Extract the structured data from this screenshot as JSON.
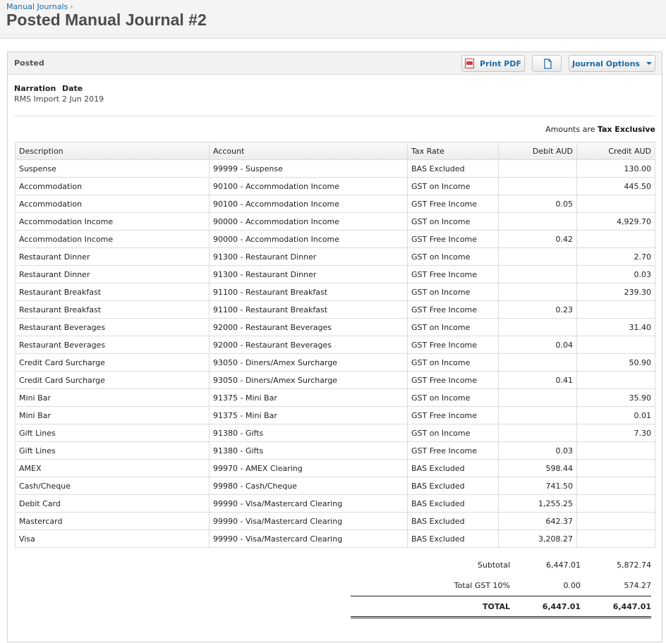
{
  "breadcrumb": {
    "link": "Manual Journals",
    "separator": "›"
  },
  "title": "Posted Manual Journal #2",
  "panel": {
    "status": "Posted",
    "print_pdf_label": "Print PDF",
    "copy_icon": "copy-icon",
    "journal_options_label": "Journal Options"
  },
  "narration": {
    "label": "Narration",
    "value": "RMS Import"
  },
  "date": {
    "label": "Date",
    "value": "2 Jun 2019"
  },
  "amounts_note": {
    "prefix": "Amounts are",
    "value": "Tax Exclusive"
  },
  "table": {
    "columns": [
      "Description",
      "Account",
      "Tax Rate",
      "Debit AUD",
      "Credit AUD"
    ],
    "rows": [
      {
        "description": "Suspense",
        "account": "99999 - Suspense",
        "tax_rate": "BAS Excluded",
        "debit": "",
        "credit": "130.00"
      },
      {
        "description": "Accommodation",
        "account": "90100 - Accommodation Income",
        "tax_rate": "GST on Income",
        "debit": "",
        "credit": "445.50"
      },
      {
        "description": "Accommodation",
        "account": "90100 - Accommodation Income",
        "tax_rate": "GST Free Income",
        "debit": "0.05",
        "credit": ""
      },
      {
        "description": "Accommodation Income",
        "account": "90000 - Accommodation Income",
        "tax_rate": "GST on Income",
        "debit": "",
        "credit": "4,929.70"
      },
      {
        "description": "Accommodation Income",
        "account": "90000 - Accommodation Income",
        "tax_rate": "GST Free Income",
        "debit": "0.42",
        "credit": ""
      },
      {
        "description": "Restaurant Dinner",
        "account": "91300 - Restaurant Dinner",
        "tax_rate": "GST on Income",
        "debit": "",
        "credit": "2.70"
      },
      {
        "description": "Restaurant Dinner",
        "account": "91300 - Restaurant Dinner",
        "tax_rate": "GST Free Income",
        "debit": "",
        "credit": "0.03"
      },
      {
        "description": "Restaurant Breakfast",
        "account": "91100 - Restaurant Breakfast",
        "tax_rate": "GST on Income",
        "debit": "",
        "credit": "239.30"
      },
      {
        "description": "Restaurant Breakfast",
        "account": "91100 - Restaurant Breakfast",
        "tax_rate": "GST Free Income",
        "debit": "0.23",
        "credit": ""
      },
      {
        "description": "Restaurant Beverages",
        "account": "92000 - Restaurant Beverages",
        "tax_rate": "GST on Income",
        "debit": "",
        "credit": "31.40"
      },
      {
        "description": "Restaurant Beverages",
        "account": "92000 - Restaurant Beverages",
        "tax_rate": "GST Free Income",
        "debit": "0.04",
        "credit": ""
      },
      {
        "description": "Credit Card Surcharge",
        "account": "93050 - Diners/Amex Surcharge",
        "tax_rate": "GST on Income",
        "debit": "",
        "credit": "50.90"
      },
      {
        "description": "Credit Card Surcharge",
        "account": "93050 - Diners/Amex Surcharge",
        "tax_rate": "GST Free Income",
        "debit": "0.41",
        "credit": ""
      },
      {
        "description": "Mini Bar",
        "account": "91375 - Mini Bar",
        "tax_rate": "GST on Income",
        "debit": "",
        "credit": "35.90"
      },
      {
        "description": "Mini Bar",
        "account": "91375 - Mini Bar",
        "tax_rate": "GST Free Income",
        "debit": "",
        "credit": "0.01"
      },
      {
        "description": "Gift Lines",
        "account": "91380 - Gifts",
        "tax_rate": "GST on Income",
        "debit": "",
        "credit": "7.30"
      },
      {
        "description": "Gift Lines",
        "account": "91380 - Gifts",
        "tax_rate": "GST Free Income",
        "debit": "0.03",
        "credit": ""
      },
      {
        "description": "AMEX",
        "account": "99970 - AMEX Clearing",
        "tax_rate": "BAS Excluded",
        "debit": "598.44",
        "credit": ""
      },
      {
        "description": "Cash/Cheque",
        "account": "99980 - Cash/Cheque",
        "tax_rate": "BAS Excluded",
        "debit": "741.50",
        "credit": ""
      },
      {
        "description": "Debit Card",
        "account": "99990 - Visa/Mastercard Clearing",
        "tax_rate": "BAS Excluded",
        "debit": "1,255.25",
        "credit": ""
      },
      {
        "description": "Mastercard",
        "account": "99990 - Visa/Mastercard Clearing",
        "tax_rate": "BAS Excluded",
        "debit": "642.37",
        "credit": ""
      },
      {
        "description": "Visa",
        "account": "99990 - Visa/Mastercard Clearing",
        "tax_rate": "BAS Excluded",
        "debit": "3,208.27",
        "credit": ""
      }
    ]
  },
  "totals": {
    "subtotal": {
      "label": "Subtotal",
      "debit": "6,447.01",
      "credit": "5,872.74"
    },
    "gst": {
      "label": "Total GST 10%",
      "debit": "0.00",
      "credit": "574.27"
    },
    "total": {
      "label": "TOTAL",
      "debit": "6,447.01",
      "credit": "6,447.01"
    }
  },
  "colors": {
    "link": "#1a6aa8",
    "header_bg": "#f4f4f4",
    "border": "#dcdcdc"
  }
}
